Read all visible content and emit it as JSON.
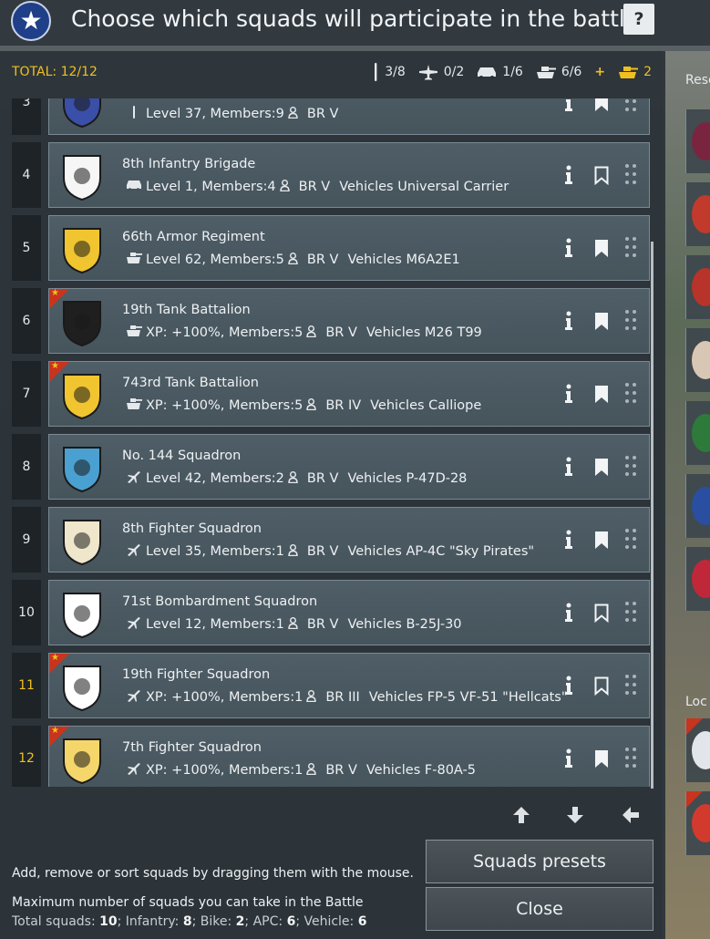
{
  "header": {
    "title": "Choose which squads will participate in the battle",
    "help_label": "?"
  },
  "summary": {
    "total": "TOTAL: 12/12",
    "counts": [
      {
        "icon": "infantry-icon",
        "value": "3/8"
      },
      {
        "icon": "plane-icon",
        "value": "0/2"
      },
      {
        "icon": "apc-icon",
        "value": "1/6"
      },
      {
        "icon": "tank-icon",
        "value": "6/6"
      }
    ],
    "plus": "+",
    "bonus": "2"
  },
  "reserve": {
    "label": "Rese"
  },
  "local": {
    "label": "Loc"
  },
  "squads": [
    {
      "num": "3",
      "name": "",
      "icon": "infantry-icon",
      "details": "Level 37, Members:9",
      "member_icon": "person-icon",
      "br": "BR V",
      "vehicles": "",
      "bookmark_filled": true,
      "premium": false,
      "num_gold": false
    },
    {
      "num": "4",
      "name": "8th Infantry Brigade",
      "icon": "apc-icon",
      "details": "Level 1, Members:4",
      "br": "BR V",
      "vehicles": "Vehicles Universal Carrier",
      "bookmark_filled": false,
      "premium": false,
      "num_gold": false
    },
    {
      "num": "5",
      "name": "66th Armor Regiment",
      "icon": "tank-icon",
      "details": "Level 62, Members:5",
      "br": "BR V",
      "vehicles": "Vehicles M6A2E1",
      "bookmark_filled": true,
      "premium": false,
      "num_gold": false
    },
    {
      "num": "6",
      "name": "19th Tank Battalion",
      "icon": "tank-icon",
      "details": "XP: +100%, Members:5",
      "br": "BR V",
      "vehicles": "Vehicles M26 T99",
      "bookmark_filled": true,
      "premium": true,
      "num_gold": false
    },
    {
      "num": "7",
      "name": "743rd Tank Battalion",
      "icon": "tank-icon",
      "details": "XP: +100%, Members:5",
      "br": "BR IV",
      "vehicles": "Vehicles Calliope",
      "bookmark_filled": true,
      "premium": true,
      "num_gold": false
    },
    {
      "num": "8",
      "name": "No. 144 Squadron",
      "icon": "plane-icon",
      "details": "Level 42, Members:2",
      "br": "BR V",
      "vehicles": "Vehicles P-47D-28",
      "bookmark_filled": true,
      "premium": false,
      "num_gold": false
    },
    {
      "num": "9",
      "name": "8th Fighter Squadron",
      "icon": "plane-icon",
      "details": "Level 35, Members:1",
      "br": "BR V",
      "vehicles": "Vehicles AP-4C \"Sky Pirates\"",
      "bookmark_filled": true,
      "premium": false,
      "num_gold": false
    },
    {
      "num": "10",
      "name": "71st Bombardment Squadron",
      "icon": "plane-icon",
      "details": "Level 12, Members:1",
      "br": "BR V",
      "vehicles": "Vehicles B-25J-30",
      "bookmark_filled": false,
      "premium": false,
      "num_gold": false
    },
    {
      "num": "11",
      "name": "19th Fighter Squadron",
      "icon": "plane-icon",
      "details": "XP: +100%, Members:1",
      "br": "BR III",
      "vehicles": "Vehicles FP-5 VF-51 \"Hellcats\"",
      "bookmark_filled": false,
      "premium": true,
      "num_gold": true
    },
    {
      "num": "12",
      "name": "7th Fighter Squadron",
      "icon": "plane-icon",
      "details": "XP: +100%, Members:1",
      "br": "BR V",
      "vehicles": "Vehicles F-80A-5",
      "bookmark_filled": true,
      "premium": true,
      "num_gold": true
    }
  ],
  "nav": {
    "up": "arrow-up-icon",
    "down": "arrow-down-icon",
    "back": "arrow-left-icon"
  },
  "hints": {
    "drag": "Add, remove or sort squads by dragging them with the mouse.",
    "max": "Maximum number of squads you can take in the Battle",
    "totals_prefix": "Total squads:",
    "totals_squads": "10",
    "infantry_label": "; Infantry:",
    "infantry": "8",
    "bike_label": "; Bike:",
    "bike": "2",
    "apc_label": "; APC:",
    "apc": "6",
    "vehicle_label": "; Vehicle:",
    "vehicle": "6"
  },
  "buttons": {
    "presets": "Squads presets",
    "close": "Close"
  },
  "colors": {
    "gold": "#f0c020",
    "ribbon": "#c8341e",
    "card": "#4f5e67"
  }
}
